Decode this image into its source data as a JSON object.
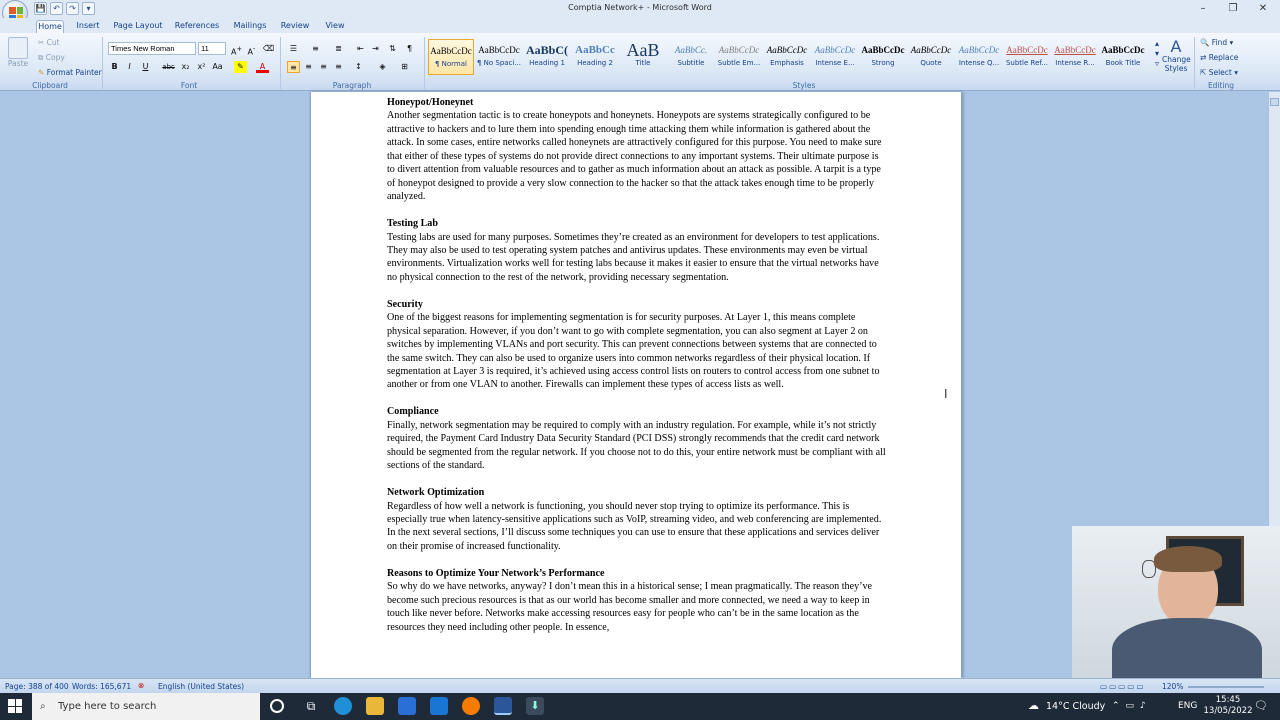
{
  "window": {
    "title": "Comptia Network+ - Microsoft Word",
    "minimize": "–",
    "maximize": "❐",
    "close": "✕"
  },
  "qat": [
    "💾",
    "↶",
    "↷",
    "▾"
  ],
  "tabs": [
    {
      "label": "Home",
      "active": true
    },
    {
      "label": "Insert"
    },
    {
      "label": "Page Layout"
    },
    {
      "label": "References"
    },
    {
      "label": "Mailings"
    },
    {
      "label": "Review"
    },
    {
      "label": "View"
    }
  ],
  "clipboard": {
    "paste": "Paste",
    "cut": "Cut",
    "copy": "Copy",
    "format_painter": "Format Painter",
    "label": "Clipboard"
  },
  "font": {
    "name": "Times New Roman",
    "size": "11",
    "label": "Font",
    "buttons": [
      "B",
      "I",
      "U",
      "abc",
      "x₂",
      "x²",
      "Aa"
    ]
  },
  "paragraph": {
    "label": "Paragraph"
  },
  "styles": {
    "label": "Styles",
    "items": [
      {
        "preview": "AaBbCcDc",
        "name": "¶ Normal",
        "selected": true
      },
      {
        "preview": "AaBbCcDc",
        "name": "¶ No Spaci..."
      },
      {
        "preview": "AaBbC(",
        "name": "Heading 1"
      },
      {
        "preview": "AaBbCc",
        "name": "Heading 2"
      },
      {
        "preview": "AaB",
        "name": "Title"
      },
      {
        "preview": "AaBbCc.",
        "name": "Subtitle"
      },
      {
        "preview": "AaBbCcDc",
        "name": "Subtle Em..."
      },
      {
        "preview": "AaBbCcDc",
        "name": "Emphasis"
      },
      {
        "preview": "AaBbCcDc",
        "name": "Intense E..."
      },
      {
        "preview": "AaBbCcDc",
        "name": "Strong"
      },
      {
        "preview": "AaBbCcDc",
        "name": "Quote"
      },
      {
        "preview": "AaBbCcDc",
        "name": "Intense Q..."
      },
      {
        "preview": "AaBbCcDc",
        "name": "Subtle Ref..."
      },
      {
        "preview": "AaBbCcDc",
        "name": "Intense R..."
      },
      {
        "preview": "AaBbCcDc",
        "name": "Book Title"
      }
    ],
    "change_styles": "Change Styles"
  },
  "editing": {
    "find": "Find",
    "replace": "Replace",
    "select": "Select",
    "label": "Editing"
  },
  "document": {
    "sections": [
      {
        "heading": "Honeypot/Honeynet",
        "body": "Another segmentation tactic is to create honeypots and honeynets. Honeypots are systems strategically configured to be attractive to hackers and to lure them into spending enough time attacking them while information is gathered about the attack. In some cases, entire networks called honeynets are attractively configured for this purpose. You need to make sure that either of these types of systems do not provide direct connections to any important systems. Their ultimate purpose is to divert attention from valuable resources and to gather as much information about an attack as possible. A tarpit is a type of honeypot designed to provide a very slow connection to the hacker so that the attack takes enough time to be properly analyzed."
      },
      {
        "heading": "Testing Lab",
        "body": "Testing labs are used for many purposes. Sometimes they’re created as an environment for developers to test applications. They may also be used to test operating system patches and antivirus updates. These environments may even be virtual environments. Virtualization works well for testing labs because it makes it easier to ensure that the virtual networks have no physical connection to the rest of the network, providing necessary segmentation."
      },
      {
        "heading": "Security",
        "body": "One of the biggest reasons for implementing segmentation is for security purposes. At Layer 1, this means complete physical separation. However, if you don’t want to go with complete segmentation, you can also segment at Layer 2 on switches by implementing VLANs and port security. This can prevent connections between systems that are connected to the same switch. They can also be used to organize users into common networks regardless of their physical location. If segmentation at Layer 3 is required, it’s achieved using access control lists on routers to control access from one subnet to another or from one VLAN to another. Firewalls can implement these types of access lists as well."
      },
      {
        "heading": "Compliance",
        "body": "Finally, network segmentation may be required to comply with an industry regulation. For example, while it’s not strictly required, the Payment Card Industry Data Security Standard (PCI DSS) strongly recommends that the credit card network should be segmented from the regular network. If you choose not to do this, your entire network must be compliant with all sections of the standard."
      },
      {
        "heading": "Network Optimization",
        "body": "Regardless of how well a network is functioning, you should never stop trying to optimize its performance. This is especially true when latency-sensitive applications such as VoIP, streaming video, and web conferencing are implemented. In the next several sections, I’ll discuss some techniques you can use to ensure that these applications and services deliver on their promise of increased functionality."
      },
      {
        "heading": "Reasons to Optimize Your Network’s Performance",
        "body": "So why do we have networks, anyway? I don’t mean this in a historical sense; I mean pragmatically. The reason they’ve become such precious resources is that as our world has become smaller and more connected, we need a way to keep in touch like never before. Networks make accessing resources easy for people who can’t be in the same location as the resources they need including other people. In essence,"
      }
    ]
  },
  "status": {
    "page": "Page: 388 of 400",
    "words": "Words: 165,671",
    "language": "English (United States)",
    "zoom": "120%"
  },
  "taskbar": {
    "search_placeholder": "Type here to search",
    "weather": "14°C  Cloudy",
    "lang": "ENG",
    "time": "15:45",
    "date": "13/05/2022"
  },
  "colors": {
    "ribbon": "#dbe7f5",
    "doc_bg": "#abc5e4",
    "taskbar": "#1e2a38"
  }
}
